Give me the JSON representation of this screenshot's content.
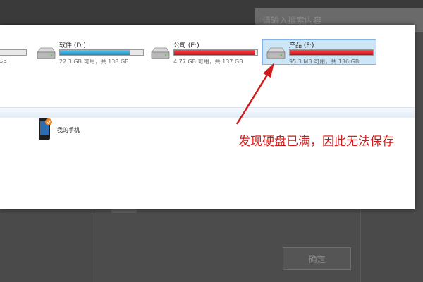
{
  "background": {
    "app_title": "",
    "search_placeholder": "请输入搜索内容",
    "ok_button": "确定"
  },
  "drives": [
    {
      "label": "",
      "size": "GB",
      "used_fraction": 0.0,
      "color": "#e8e8e8"
    },
    {
      "label": "软件 (D:)",
      "size": "22.3 GB 可用，共 138 GB",
      "used_fraction": 0.84,
      "color": "#2aa7d9"
    },
    {
      "label": "公司 (E:)",
      "size": "4.77 GB 可用，共 137 GB",
      "used_fraction": 0.97,
      "color": "#d8141e"
    },
    {
      "label": "产品 (F:)",
      "size": "95.3 MB 可用，共 136 GB",
      "used_fraction": 0.999,
      "color": "#d8141e"
    }
  ],
  "device": {
    "label": "我的手机"
  },
  "annotation": "发现硬盘已满，因此无法保存",
  "colors": {
    "annotation": "#d31a1a",
    "selection": "#cde6f7"
  }
}
